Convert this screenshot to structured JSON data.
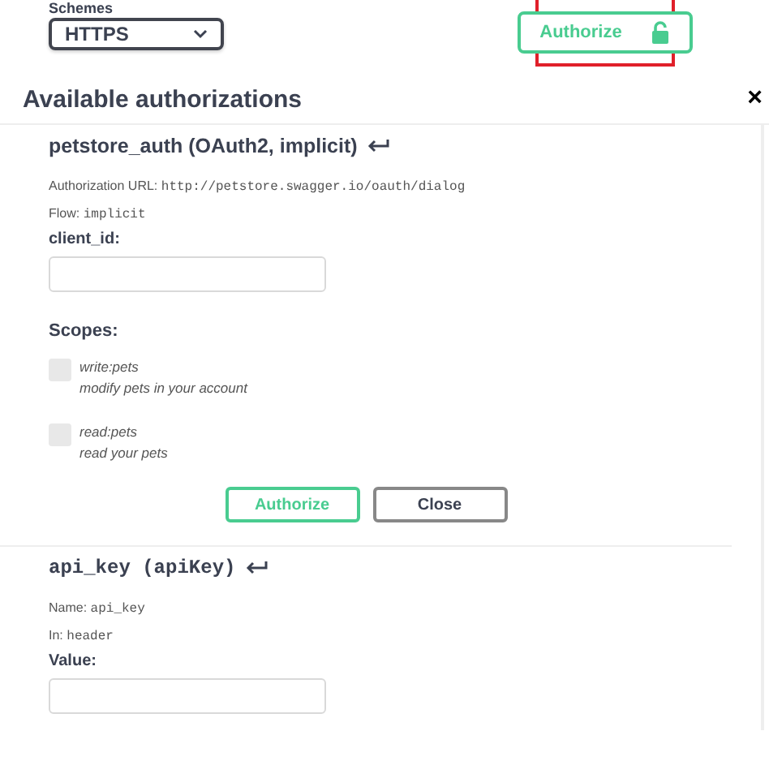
{
  "schemes": {
    "label": "Schemes",
    "value": "HTTPS"
  },
  "authorize_button": {
    "label": "Authorize",
    "locked": false
  },
  "modal": {
    "title": "Available authorizations",
    "close": "×",
    "sections": [
      {
        "kind": "oauth",
        "title": "petstore_auth (OAuth2, implicit)",
        "details": [
          {
            "label": "Authorization URL:",
            "value": "http://petstore.swagger.io/oauth/dialog"
          },
          {
            "label": "Flow:",
            "value": "implicit"
          }
        ],
        "field_label": "client_id:",
        "scopes_label": "Scopes:",
        "scopes": [
          {
            "name": "write:pets",
            "description": "modify pets in your account",
            "checked": false
          },
          {
            "name": "read:pets",
            "description": "read your pets",
            "checked": false
          }
        ],
        "buttons": [
          "Authorize",
          "Close"
        ]
      },
      {
        "kind": "apikey",
        "title": "api_key (apiKey)",
        "details": [
          {
            "label": "Name:",
            "value": "api_key"
          },
          {
            "label": "In:",
            "value": "header"
          }
        ],
        "field_label": "Value:"
      }
    ]
  }
}
